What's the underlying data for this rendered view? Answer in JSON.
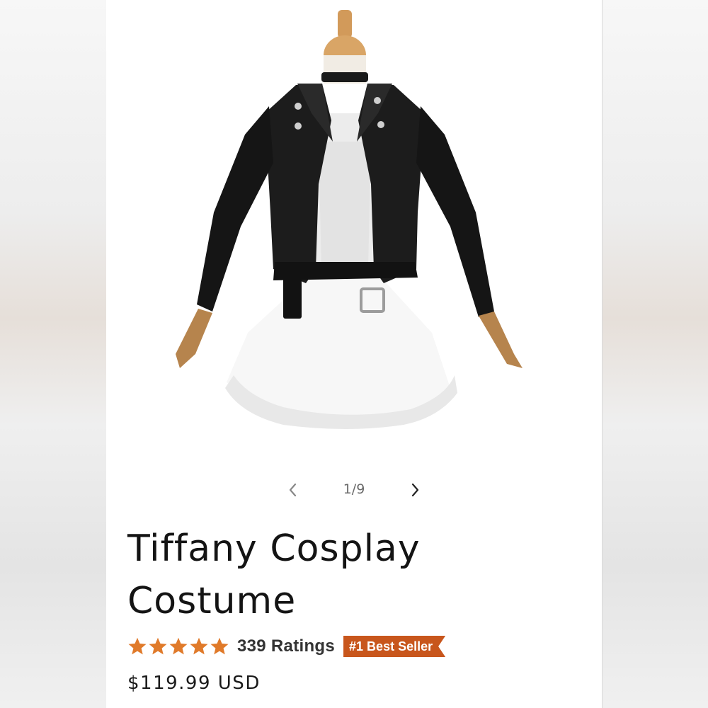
{
  "carousel": {
    "counter": "1/9",
    "prev_icon": "chevron-left-icon",
    "next_icon": "chevron-right-icon"
  },
  "product": {
    "title": "Tiffany Cosplay Costume",
    "rating_stars": 5,
    "rating_count_label": "339 Ratings",
    "badge": "#1 Best Seller",
    "price": "$119.99 USD"
  },
  "colors": {
    "star": "#e07a2a",
    "badge": "#c8561c",
    "text": "#141414"
  }
}
